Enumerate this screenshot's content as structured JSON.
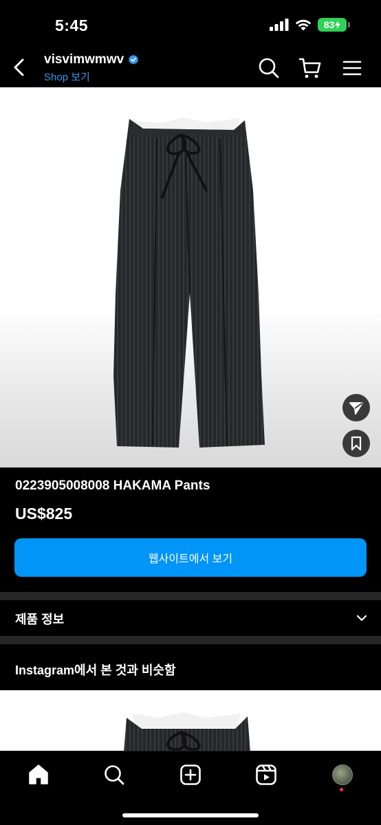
{
  "status_bar": {
    "time": "5:45",
    "battery": "83"
  },
  "header": {
    "account_name": "visvimwmwv",
    "shop_link": "Shop 보기"
  },
  "product": {
    "title": "0223905008008 HAKAMA Pants",
    "price": "US$825",
    "website_button": "웹사이트에서 보기"
  },
  "sections": {
    "product_info": "제품 정보",
    "similar": "Instagram에서 본 것과 비슷함"
  },
  "icons": {
    "back": "chevron-left-icon",
    "search": "search-icon",
    "cart": "cart-icon",
    "menu": "hamburger-icon",
    "share": "send-icon",
    "save": "bookmark-icon",
    "nav": [
      "home-icon",
      "search-icon",
      "create-icon",
      "reels-icon",
      "profile-avatar"
    ]
  },
  "colors": {
    "accent": "#0095f6",
    "link": "#3897f0",
    "verified": "#3897f0",
    "battery": "#30d158",
    "notification": "#ff3040"
  }
}
